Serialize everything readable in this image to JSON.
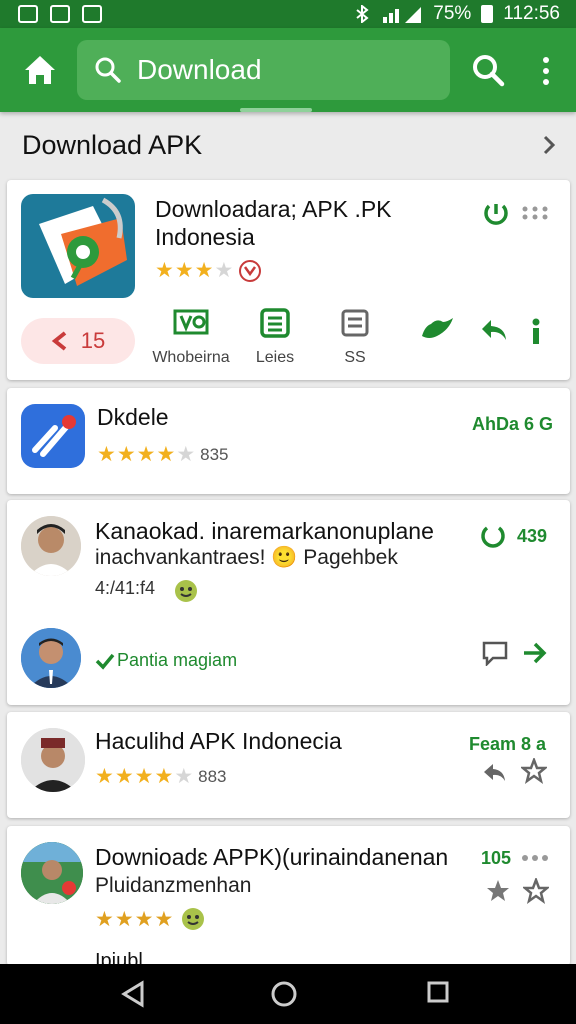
{
  "status": {
    "battery": "75%",
    "time": "112:56"
  },
  "search": {
    "text": "Download"
  },
  "section": {
    "title": "Download APK"
  },
  "featured": {
    "name_line1": "Downloadara; APK .PK",
    "name_line2": "Indonesia",
    "rating": 3,
    "pill_count": "15",
    "actions": [
      {
        "label": "Whobeirna",
        "icon": "media-icon"
      },
      {
        "label": "Leies",
        "icon": "list-icon"
      },
      {
        "label": "SS",
        "icon": "notes-icon"
      }
    ]
  },
  "items": [
    {
      "name": "Dkdele",
      "rating": 4,
      "count": "835",
      "right_label": "AhDa 6 G"
    },
    {
      "name": "Kanaokad. inaremarkanonuplane",
      "line2": "inachvankantraes! 🙂 Pagehbek",
      "meta": "4:/41:f4",
      "count_badge": "439",
      "reply_text": "Pantia magiam"
    },
    {
      "name": "Haculihd APK Indonecia",
      "rating": 4,
      "count": "883",
      "right_label": "Feam 8 a"
    },
    {
      "name": "Downioadɛ APPK)(urinaindanenan",
      "line2": "Pluidanzmenhan",
      "rating": 4,
      "right_label": "105"
    },
    {
      "name": "Ipiubl"
    }
  ],
  "colors": {
    "primary": "#2e9a3c",
    "status_bar": "#1f7a2c",
    "accent_green": "#1f8a2f",
    "star": "#f2b01e"
  }
}
